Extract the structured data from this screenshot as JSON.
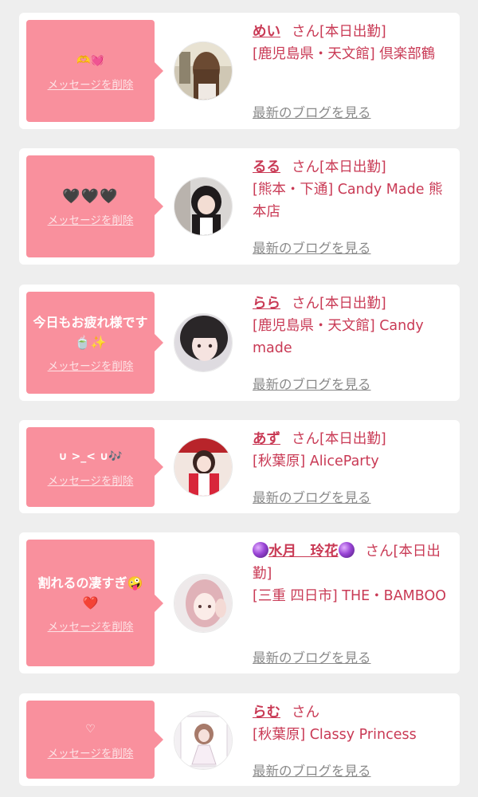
{
  "list": {
    "delete_label": "メッセージを削除",
    "blog_label": "最新のブログを見る",
    "san_label": "さん",
    "items": [
      {
        "message": "🫶💓",
        "name": "めい",
        "status": "[本日出勤]",
        "shop": "[鹿児島県・天文館] 倶楽部鶴",
        "avatar_icon": "avatar-photo-long-hair"
      },
      {
        "message": "🖤🖤🖤",
        "name": "るる",
        "status": "[本日出勤]",
        "shop": "[熊本・下通] Candy Made 熊本店",
        "avatar_icon": "avatar-photo-maid"
      },
      {
        "message": "今日もお疲れ様です🍵✨",
        "name": "らら",
        "status": "[本日出勤]",
        "shop": "[鹿児島県・天文館] Candy made",
        "avatar_icon": "avatar-photo-face"
      },
      {
        "message": "∪ >_< ∪🎶",
        "name": "あず",
        "status": "[本日出勤]",
        "shop": "[秋葉原] AliceParty",
        "avatar_icon": "avatar-photo-red-costume"
      },
      {
        "message": "割れるの凄すぎ🤪❤️",
        "name": "水月　玲花",
        "status": "[本日出勤]",
        "shop": "[三重 四日市] THE・BAMBOO",
        "avatar_icon": "avatar-photo-pink-hair"
      },
      {
        "message": "♡",
        "name": "らむ",
        "status": "",
        "shop": "[秋葉原] Classy Princess",
        "avatar_icon": "avatar-photo-white-dress"
      }
    ]
  },
  "colors": {
    "accent": "#c93a55",
    "bubble": "#f9909d",
    "background": "#eeeeee",
    "card": "#ffffff",
    "link_gray": "#8a8a8a"
  }
}
